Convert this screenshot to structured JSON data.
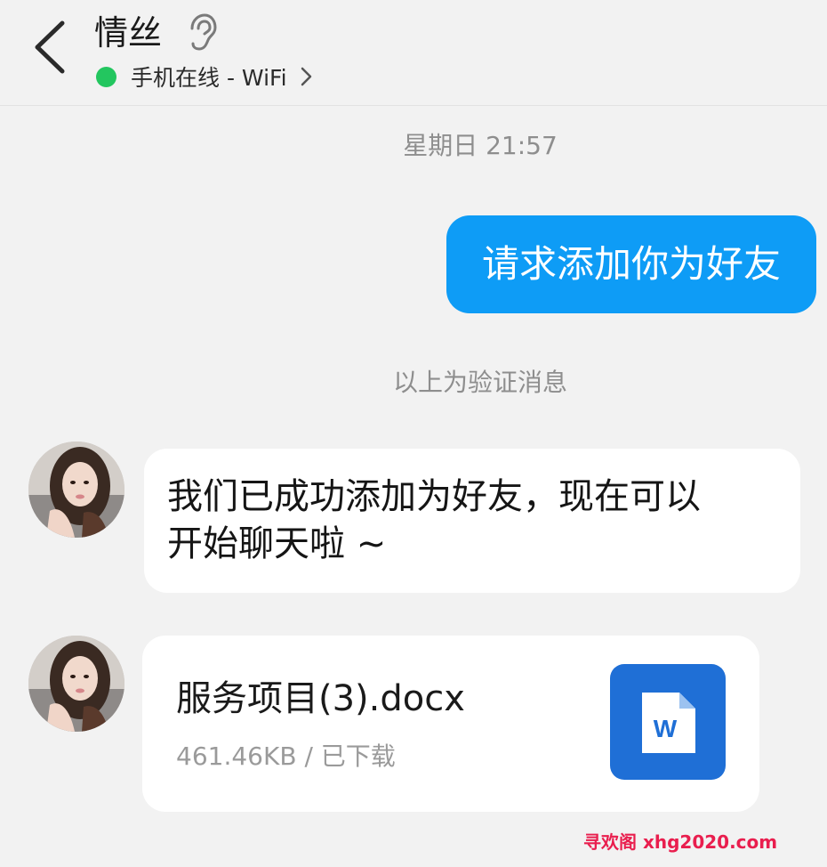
{
  "header": {
    "contact_name": "情丝",
    "status_text": "手机在线 - WiFi",
    "status_color": "#23c65f"
  },
  "conversation": {
    "timestamp": "星期日 21:57",
    "outgoing_message": "请求添加你为好友",
    "verification_note": "以上为验证消息",
    "incoming_message_line1": "我们已成功添加为好友，现在可以",
    "incoming_message_line2": "开始聊天啦 ~",
    "file": {
      "name": "服务项目(3).docx",
      "meta": "461.46KB / 已下载",
      "icon": "word-document-icon"
    }
  },
  "watermark": "寻欢阁 xhg2020.com",
  "colors": {
    "outgoing_bubble": "#0e9cf6",
    "background": "#f2f2f2",
    "word_icon": "#1f6fd6",
    "watermark": "#e91e4e"
  }
}
